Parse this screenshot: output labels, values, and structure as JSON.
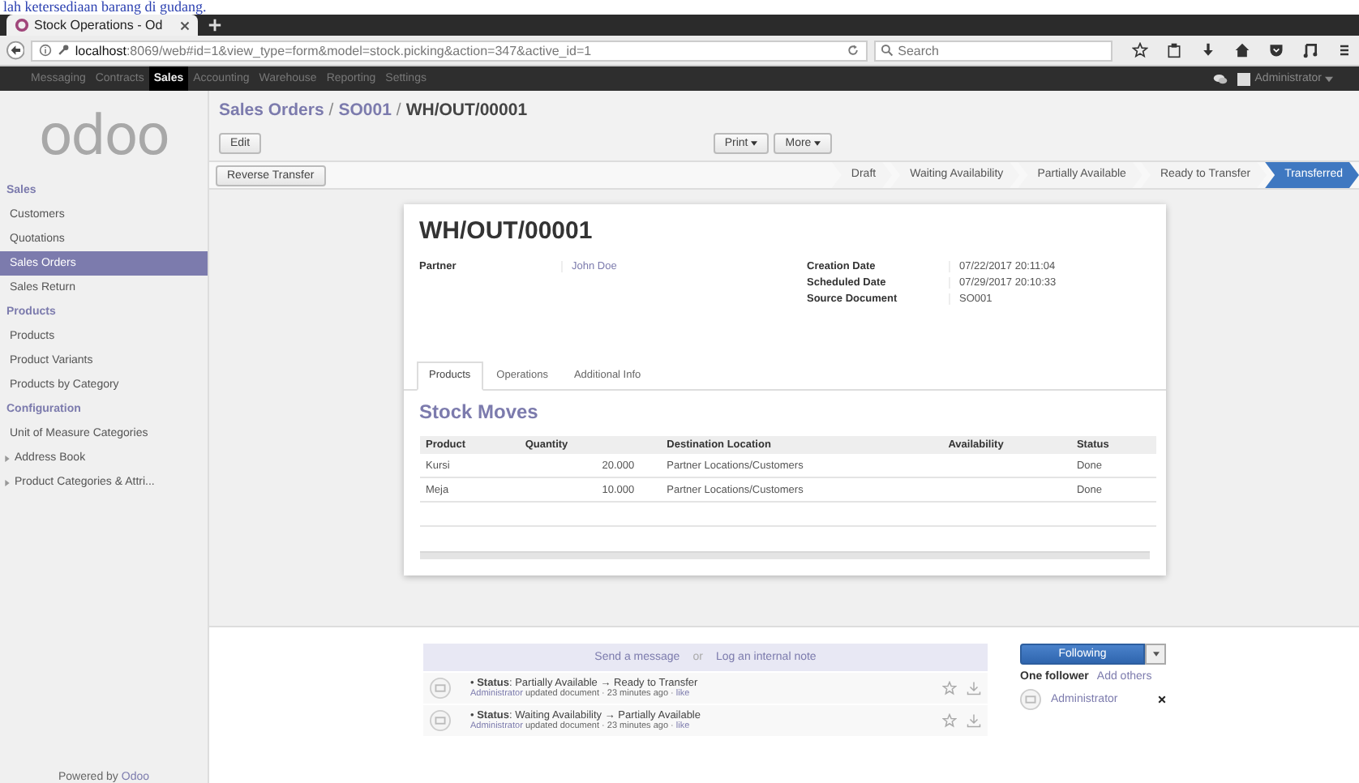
{
  "caption": "lah ketersediaan barang di gudang.",
  "browser": {
    "tab_title": "Stock Operations - Od",
    "url_host": "localhost",
    "url_rest": ":8069/web#id=1&view_type=form&model=stock.picking&action=347&active_id=1",
    "search_placeholder": "Search"
  },
  "top_menu": [
    {
      "label": "Messaging",
      "selected": false
    },
    {
      "label": "Contracts",
      "selected": false
    },
    {
      "label": "Sales",
      "selected": true
    },
    {
      "label": "Accounting",
      "selected": false
    },
    {
      "label": "Warehouse",
      "selected": false
    },
    {
      "label": "Reporting",
      "selected": false
    },
    {
      "label": "Settings",
      "selected": false
    }
  ],
  "user": "Administrator",
  "sidebar": {
    "logo": "odoo",
    "sections": [
      {
        "title": "Sales",
        "items": [
          {
            "label": "Customers",
            "selected": false,
            "expandable": false
          },
          {
            "label": "Quotations",
            "selected": false,
            "expandable": false
          },
          {
            "label": "Sales Orders",
            "selected": true,
            "expandable": false
          },
          {
            "label": "Sales Return",
            "selected": false,
            "expandable": false
          }
        ]
      },
      {
        "title": "Products",
        "items": [
          {
            "label": "Products",
            "selected": false,
            "expandable": false
          },
          {
            "label": "Product Variants",
            "selected": false,
            "expandable": false
          },
          {
            "label": "Products by Category",
            "selected": false,
            "expandable": false
          }
        ]
      },
      {
        "title": "Configuration",
        "items": [
          {
            "label": "Unit of Measure Categories",
            "selected": false,
            "expandable": false
          },
          {
            "label": "Address Book",
            "selected": false,
            "expandable": true
          },
          {
            "label": "Product Categories & Attri...",
            "selected": false,
            "expandable": true
          }
        ]
      }
    ],
    "footer_text": "Powered by",
    "footer_link": "Odoo"
  },
  "breadcrumb": [
    {
      "label": "Sales Orders",
      "kind": "link"
    },
    {
      "label": "/",
      "kind": "sep"
    },
    {
      "label": "SO001",
      "kind": "link"
    },
    {
      "label": "/",
      "kind": "sep"
    },
    {
      "label": "WH/OUT/00001",
      "kind": "current"
    }
  ],
  "edit_button": "Edit",
  "print_button": "Print",
  "more_button": "More",
  "reverse_button": "Reverse Transfer",
  "stages": [
    {
      "label": "Draft",
      "selected": false
    },
    {
      "label": "Waiting Availability",
      "selected": false
    },
    {
      "label": "Partially Available",
      "selected": false
    },
    {
      "label": "Ready to Transfer",
      "selected": false
    },
    {
      "label": "Transferred",
      "selected": true
    }
  ],
  "form": {
    "title": "WH/OUT/00001",
    "left_fields": [
      {
        "label": "Partner",
        "value": "John Doe",
        "kind": "link"
      }
    ],
    "right_fields": [
      {
        "label": "Creation Date",
        "value": "07/22/2017 20:11:04",
        "kind": "text"
      },
      {
        "label": "Scheduled Date",
        "value": "07/29/2017 20:10:33",
        "kind": "text"
      },
      {
        "label": "Source Document",
        "value": "SO001",
        "kind": "text"
      }
    ],
    "tabs": [
      {
        "label": "Products",
        "selected": true
      },
      {
        "label": "Operations",
        "selected": false
      },
      {
        "label": "Additional Info",
        "selected": false
      }
    ],
    "section_title": "Stock Moves",
    "table": {
      "columns": [
        "Product",
        "Quantity",
        "Destination Location",
        "Availability",
        "Status"
      ],
      "rows": [
        [
          "Kursi",
          "20.000",
          "Partner Locations/Customers",
          "",
          "Done"
        ],
        [
          "Meja",
          "10.000",
          "Partner Locations/Customers",
          "",
          "Done"
        ]
      ]
    }
  },
  "chatter": {
    "send": "Send a message",
    "or": "or",
    "log": "Log an internal note",
    "messages": [
      {
        "text": "• **Status**: Partially Available → Ready to Transfer",
        "author": "Administrator",
        "meta": "updated document · 23 minutes ago ·",
        "like": "like"
      },
      {
        "text": "• **Status**: Waiting Availability → Partially Available",
        "author": "Administrator",
        "meta": "updated document · 23 minutes ago ·",
        "like": "like"
      }
    ],
    "follow_button": "Following",
    "follower_count": "One follower",
    "add_followers": "Add others",
    "followers": [
      "Administrator"
    ]
  }
}
